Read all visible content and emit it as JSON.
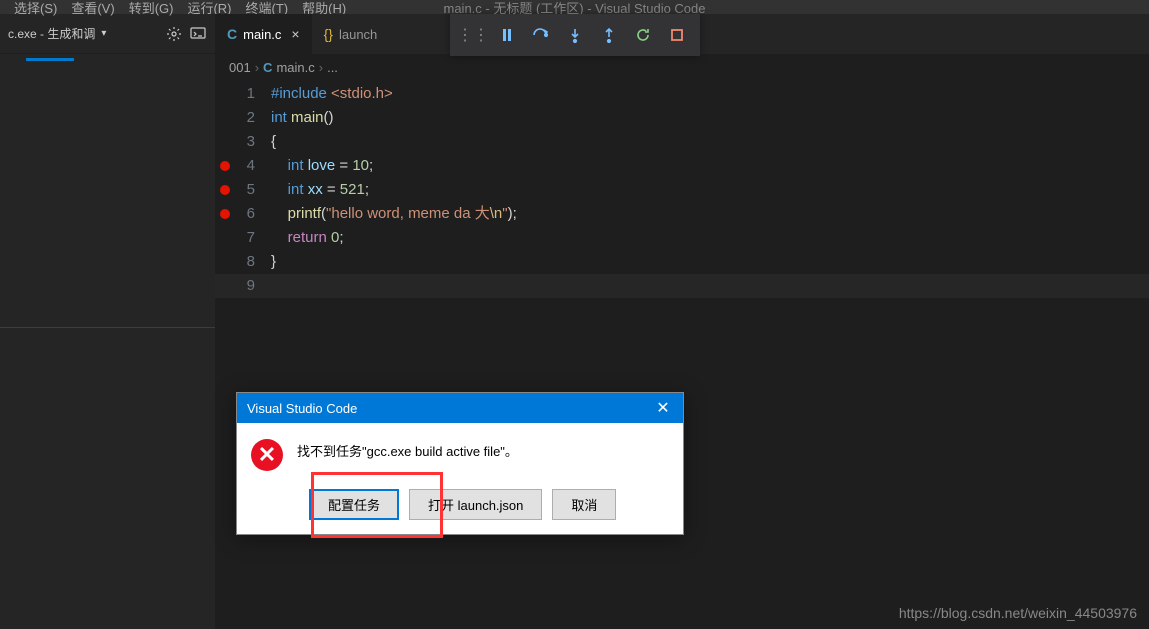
{
  "menubar": {
    "items": [
      "选择(S)",
      "查看(V)",
      "转到(G)",
      "运行(R)",
      "终端(T)",
      "帮助(H)"
    ],
    "title": "main.c - 无标题 (工作区) - Visual Studio Code"
  },
  "sidebarHead": {
    "label": "c.exe - 生成和调"
  },
  "tabs": [
    {
      "icon": "C",
      "label": "main.c",
      "active": true,
      "closable": true
    },
    {
      "icon": "{}",
      "label": "launch",
      "active": false,
      "closable": false
    }
  ],
  "breadcrumb": {
    "a": "001",
    "b": "main.c",
    "c": "..."
  },
  "code": {
    "lines": [
      {
        "n": 1,
        "bp": false,
        "tokens": [
          [
            "tok-inc",
            "#include "
          ],
          [
            "tok-str",
            "<stdio.h>"
          ]
        ]
      },
      {
        "n": 2,
        "bp": false,
        "tokens": [
          [
            "tok-type",
            "int "
          ],
          [
            "tok-func",
            "main"
          ],
          [
            "tok-pun",
            "()"
          ]
        ]
      },
      {
        "n": 3,
        "bp": false,
        "tokens": [
          [
            "tok-pun",
            "{"
          ]
        ]
      },
      {
        "n": 4,
        "bp": true,
        "tokens": [
          [
            "tok-pun",
            "    "
          ],
          [
            "tok-type",
            "int "
          ],
          [
            "tok-var",
            "love"
          ],
          [
            "tok-pun",
            " = "
          ],
          [
            "tok-num",
            "10"
          ],
          [
            "tok-pun",
            ";"
          ]
        ]
      },
      {
        "n": 5,
        "bp": true,
        "tokens": [
          [
            "tok-pun",
            "    "
          ],
          [
            "tok-type",
            "int "
          ],
          [
            "tok-var",
            "xx"
          ],
          [
            "tok-pun",
            " = "
          ],
          [
            "tok-num",
            "521"
          ],
          [
            "tok-pun",
            ";"
          ]
        ]
      },
      {
        "n": 6,
        "bp": true,
        "tokens": [
          [
            "tok-pun",
            "    "
          ],
          [
            "tok-func",
            "printf"
          ],
          [
            "tok-pun",
            "("
          ],
          [
            "tok-str",
            "\"hello word, meme da 大"
          ],
          [
            "tok-esc",
            "\\n"
          ],
          [
            "tok-str",
            "\""
          ],
          [
            "tok-pun",
            ");"
          ]
        ]
      },
      {
        "n": 7,
        "bp": false,
        "tokens": [
          [
            "tok-pun",
            "    "
          ],
          [
            "tok-key",
            "return "
          ],
          [
            "tok-num",
            "0"
          ],
          [
            "tok-pun",
            ";"
          ]
        ]
      },
      {
        "n": 8,
        "bp": false,
        "tokens": [
          [
            "tok-pun",
            "}"
          ]
        ]
      },
      {
        "n": 9,
        "bp": false,
        "tokens": [],
        "cursor": true
      }
    ]
  },
  "dialog": {
    "title": "Visual Studio Code",
    "message": "找不到任务\"gcc.exe build active file\"。",
    "buttons": {
      "configure": "配置任务",
      "open": "打开 launch.json",
      "cancel": "取消"
    }
  },
  "watermark": "https://blog.csdn.net/weixin_44503976"
}
